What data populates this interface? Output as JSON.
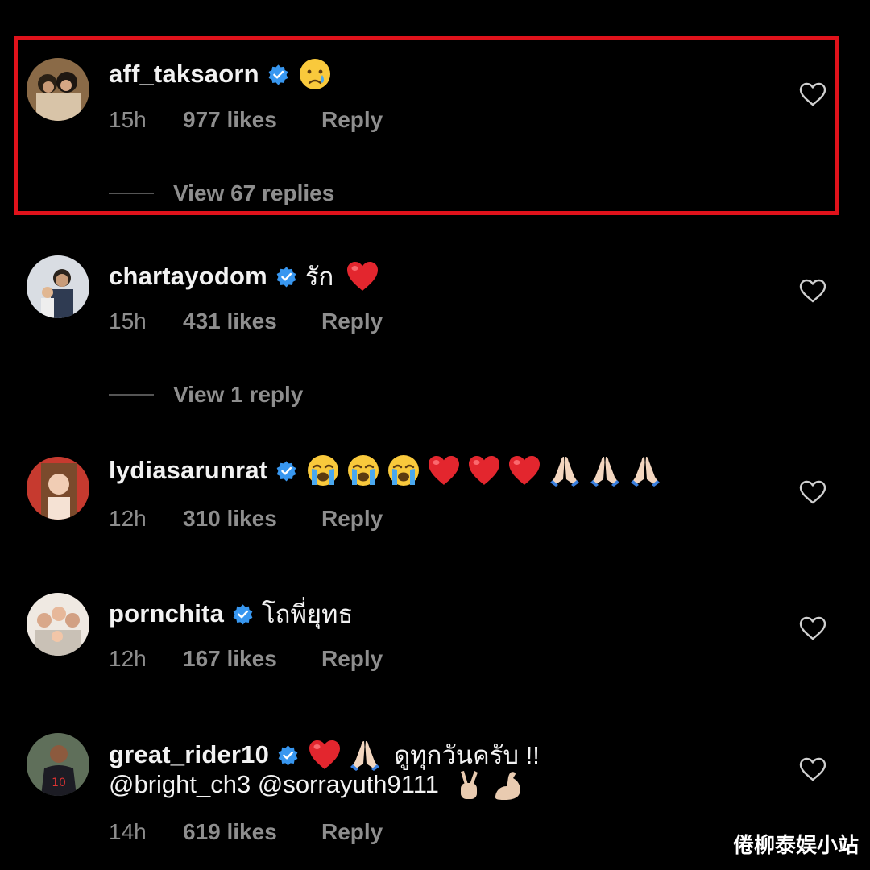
{
  "comments": [
    {
      "username": "aff_taksaorn",
      "text": "",
      "emojis": [
        "crying-face"
      ],
      "time": "15h",
      "likes": "977 likes",
      "reply": "Reply",
      "view_replies": "View 67 replies"
    },
    {
      "username": "chartayodom",
      "text": "รัก",
      "emojis": [
        "red-heart"
      ],
      "time": "15h",
      "likes": "431 likes",
      "reply": "Reply",
      "view_replies": "View 1 reply"
    },
    {
      "username": "lydiasarunrat",
      "text": "",
      "emojis": [
        "loudly-crying-face",
        "loudly-crying-face",
        "loudly-crying-face",
        "red-heart",
        "red-heart",
        "red-heart",
        "folded-hands",
        "folded-hands",
        "folded-hands"
      ],
      "time": "12h",
      "likes": "310 likes",
      "reply": "Reply"
    },
    {
      "username": "pornchita",
      "text": "โถพี่ยุทธ",
      "emojis": [],
      "time": "12h",
      "likes": "167 likes",
      "reply": "Reply"
    },
    {
      "username": "great_rider10",
      "text": "ดูทุกวันครับ !!",
      "emojis": [
        "red-heart",
        "folded-hands"
      ],
      "line2": "@bright_ch3 @sorrayuth9111",
      "line2_emojis": [
        "victory-hand",
        "flexed-biceps"
      ],
      "time": "14h",
      "likes": "619 likes",
      "reply": "Reply"
    }
  ],
  "watermark": "倦柳泰娱小站",
  "colors": {
    "highlight": "#e0121b",
    "verified": "#3897f0",
    "meta": "#8e8e8e"
  }
}
